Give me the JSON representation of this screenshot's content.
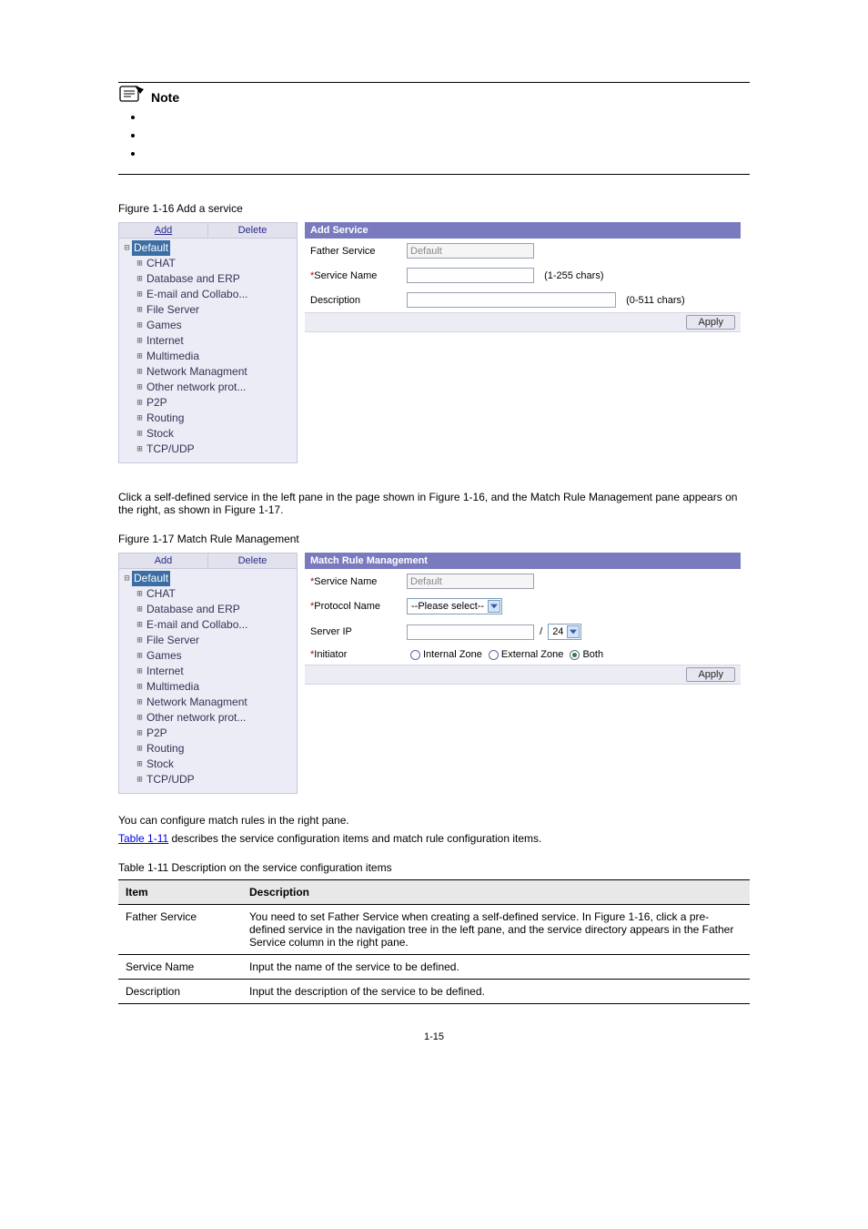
{
  "note": {
    "label": "Note",
    "bullets": [
      "",
      "",
      ""
    ]
  },
  "figure16": {
    "caption": "Figure 1-16 Add a service",
    "left_buttons": {
      "add": "Add",
      "delete": "Delete"
    },
    "tree": {
      "root": "Default",
      "items": [
        "CHAT",
        "Database and ERP",
        "E-mail and Collabo...",
        "File Server",
        "Games",
        "Internet",
        "Multimedia",
        "Network Managment",
        "Other network prot...",
        "P2P",
        "Routing",
        "Stock",
        "TCP/UDP"
      ]
    },
    "right": {
      "title": "Add Service",
      "father_label": "Father Service",
      "father_value": "Default",
      "service_name_label": "Service Name",
      "service_name_hint": "(1-255 chars)",
      "description_label": "Description",
      "description_hint": "(0-511 chars)",
      "apply": "Apply"
    }
  },
  "body_after_fig16": "Click a self-defined service in the left pane in the page shown in Figure 1-16, and the Match Rule Management pane appears on the right, as shown in Figure 1-17.",
  "figure17": {
    "caption": "Figure 1-17 Match Rule Management",
    "left_buttons": {
      "add": "Add",
      "delete": "Delete"
    },
    "tree": {
      "root": "Default",
      "items": [
        "CHAT",
        "Database and ERP",
        "E-mail and Collabo...",
        "File Server",
        "Games",
        "Internet",
        "Multimedia",
        "Network Managment",
        "Other network prot...",
        "P2P",
        "Routing",
        "Stock",
        "TCP/UDP"
      ]
    },
    "right": {
      "title": "Match Rule Management",
      "service_name_label": "Service Name",
      "service_name_value": "Default",
      "protocol_label": "Protocol Name",
      "protocol_value": "--Please select--",
      "server_ip_label": "Server IP",
      "ip_mask_value": "24",
      "initiator_label": "Initiator",
      "radio_internal": "Internal Zone",
      "radio_external": "External Zone",
      "radio_both": "Both",
      "apply": "Apply"
    }
  },
  "body_after_fig17_a": "You can configure match rules in the right pane.",
  "body_after_fig17_b_prefix": "Table 1-11",
  "body_after_fig17_b_rest": " describes the service configuration items and match rule configuration items.",
  "table11": {
    "caption": "Table 1-11 Description on the service configuration items",
    "headers": {
      "item": "Item",
      "desc": "Description"
    },
    "rows": [
      {
        "item": "Father Service",
        "desc": "You need to set Father Service when creating a self-defined service. In Figure 1-16, click a pre-defined service in the navigation tree in the left pane, and the service directory appears in the Father Service column in the right pane."
      },
      {
        "item": "Service Name",
        "desc": "Input the name of the service to be defined."
      },
      {
        "item": "Description",
        "desc": "Input the description of the service to be defined."
      }
    ]
  },
  "page_number": "1-15"
}
